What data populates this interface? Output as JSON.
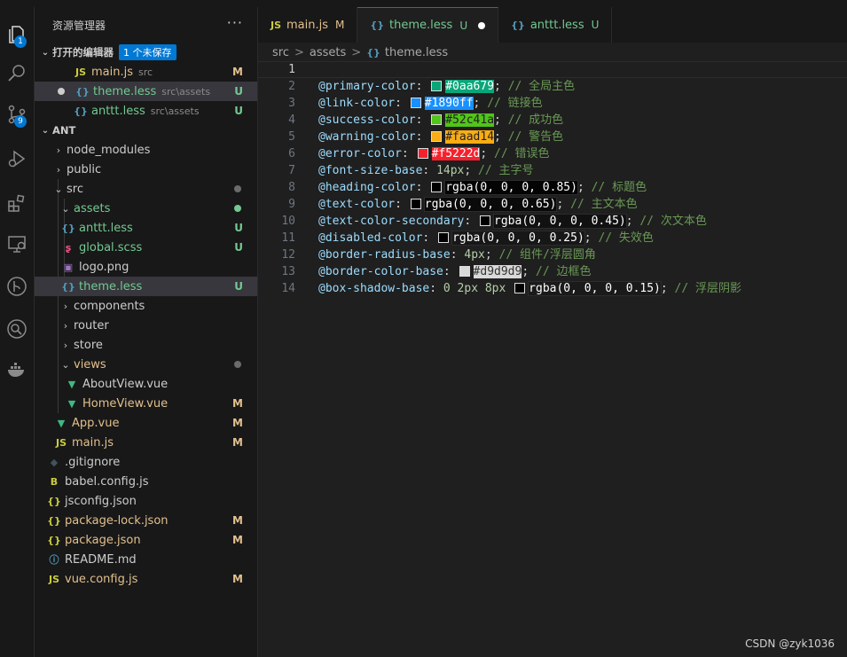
{
  "sidebar": {
    "title": "资源管理器",
    "more": "···",
    "open_editors": {
      "title": "打开的编辑器",
      "unsaved_badge": "1 个未保存",
      "items": [
        {
          "icon": "JS",
          "name": "main.js",
          "desc": "src",
          "status": "M"
        },
        {
          "icon": "{}",
          "name": "theme.less",
          "desc": "src\\assets",
          "status": "U"
        },
        {
          "icon": "{}",
          "name": "anttt.less",
          "desc": "src\\assets",
          "status": "U"
        }
      ]
    },
    "project": {
      "title": "ANT",
      "tree": [
        {
          "name": "node_modules",
          "status": ""
        },
        {
          "name": "public",
          "status": ""
        },
        {
          "name": "src",
          "status": ""
        },
        {
          "name": "assets",
          "status": ""
        },
        {
          "name": "anttt.less",
          "icon": "{}",
          "status": "U"
        },
        {
          "name": "global.scss",
          "icon": "scss",
          "status": "U"
        },
        {
          "name": "logo.png",
          "icon": "img",
          "status": ""
        },
        {
          "name": "theme.less",
          "icon": "{}",
          "status": "U"
        },
        {
          "name": "components",
          "status": ""
        },
        {
          "name": "router",
          "status": ""
        },
        {
          "name": "store",
          "status": ""
        },
        {
          "name": "views",
          "status": ""
        },
        {
          "name": "AboutView.vue",
          "icon": "V",
          "status": ""
        },
        {
          "name": "HomeView.vue",
          "icon": "V",
          "status": "M"
        },
        {
          "name": "App.vue",
          "icon": "V",
          "status": "M"
        },
        {
          "name": "main.js",
          "icon": "JS",
          "status": "M"
        },
        {
          "name": ".gitignore",
          "icon": "◆",
          "status": ""
        },
        {
          "name": "babel.config.js",
          "icon": "B",
          "status": ""
        },
        {
          "name": "jsconfig.json",
          "icon": "{}",
          "status": ""
        },
        {
          "name": "package-lock.json",
          "icon": "{}",
          "status": "M"
        },
        {
          "name": "package.json",
          "icon": "{}",
          "status": "M"
        },
        {
          "name": "README.md",
          "icon": "ⓘ",
          "status": ""
        },
        {
          "name": "vue.config.js",
          "icon": "JS",
          "status": "M"
        }
      ]
    }
  },
  "activity": {
    "explorer_badge": "1",
    "git_badge": "9"
  },
  "tabs": [
    {
      "icon": "JS",
      "label": "main.js",
      "status": "M"
    },
    {
      "icon": "{}",
      "label": "theme.less",
      "status": "U"
    },
    {
      "icon": "{}",
      "label": "anttt.less",
      "status": "U"
    }
  ],
  "breadcrumb": {
    "a": "src",
    "b": "assets",
    "c": "theme.less",
    "sep": ">"
  },
  "code": [
    {
      "n": "1"
    },
    {
      "n": "2",
      "var": "@primary-color",
      "val": "#0aa679",
      "swatch": "#0aa679",
      "cm": "// 全局主色"
    },
    {
      "n": "3",
      "var": "@link-color",
      "val": "#1890ff",
      "swatch": "#1890ff",
      "cm": "// 链接色"
    },
    {
      "n": "4",
      "var": "@success-color",
      "val": "#52c41a",
      "swatch": "#52c41a",
      "cm": "// 成功色"
    },
    {
      "n": "5",
      "var": "@warning-color",
      "val": "#faad14",
      "swatch": "#faad14",
      "cm": "// 警告色"
    },
    {
      "n": "6",
      "var": "@error-color",
      "val": "#f5222d",
      "swatch": "#f5222d",
      "cm": "// 错误色"
    },
    {
      "n": "7",
      "var": "@font-size-base",
      "val": "14px",
      "cm": "// 主字号"
    },
    {
      "n": "8",
      "var": "@heading-color",
      "val": "rgba(0, 0, 0, 0.85)",
      "swatch": "#000000",
      "cm": "// 标题色"
    },
    {
      "n": "9",
      "var": "@text-color",
      "val": "rgba(0, 0, 0, 0.65)",
      "swatch": "#000000",
      "cm": "// 主文本色"
    },
    {
      "n": "10",
      "var": "@text-color-secondary",
      "val": "rgba(0, 0, 0, 0.45)",
      "swatch": "#000000",
      "cm": "// 次文本色"
    },
    {
      "n": "11",
      "var": "@disabled-color",
      "val": "rgba(0, 0, 0, 0.25)",
      "swatch": "#000000",
      "cm": "// 失效色"
    },
    {
      "n": "12",
      "var": "@border-radius-base",
      "val": "4px",
      "cm": "// 组件/浮层圆角"
    },
    {
      "n": "13",
      "var": "@border-color-base",
      "val": "#d9d9d9",
      "swatch": "#d9d9d9",
      "cm": "// 边框色"
    },
    {
      "n": "14",
      "var": "@box-shadow-base",
      "prefix": "0 2px 8px",
      "val": "rgba(0, 0, 0, 0.15)",
      "swatch": "#000000",
      "cm": "// 浮层阴影"
    }
  ],
  "watermark": "CSDN @zyk1036"
}
